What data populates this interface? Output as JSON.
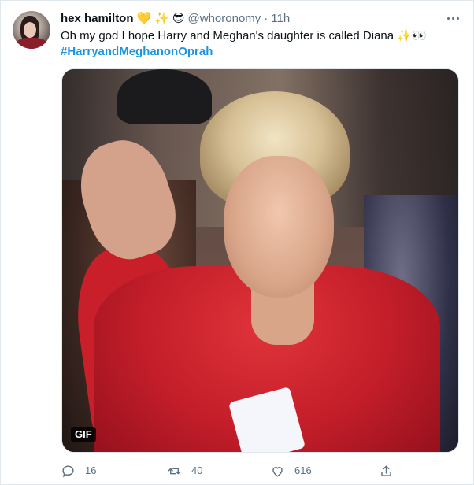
{
  "tweet": {
    "author_name": "hex hamilton",
    "author_emojis": [
      "💛",
      "✨",
      "😎"
    ],
    "handle": "@whoronomy",
    "separator": "·",
    "time": "11h",
    "text": "Oh my god I hope Harry and Meghan's daughter is called Diana ✨👀",
    "hashtag": "#HarryandMeghanonOprah",
    "media_badge": "GIF"
  },
  "actions": {
    "reply_count": "16",
    "retweet_count": "40",
    "like_count": "616"
  },
  "colors": {
    "text_primary": "#0f1419",
    "text_secondary": "#5b7083",
    "link": "#1b95e0",
    "border": "#e1e8ed",
    "jacket_red": "#c41e2a"
  },
  "icons": {
    "more": "more-horizontal-icon",
    "reply": "reply-icon",
    "retweet": "retweet-icon",
    "like": "heart-icon",
    "share": "share-icon"
  }
}
